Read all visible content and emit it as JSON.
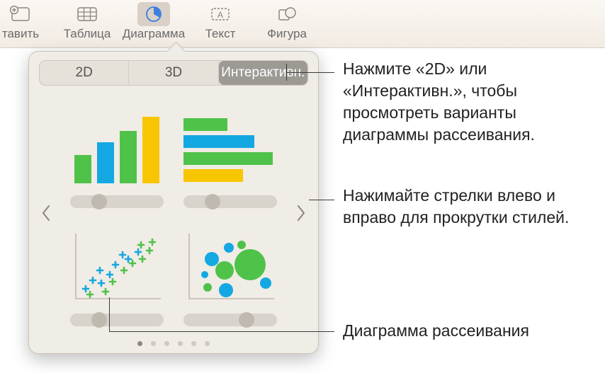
{
  "toolbar": {
    "items": [
      {
        "label": "тавить"
      },
      {
        "label": "Таблица"
      },
      {
        "label": "Диаграмма"
      },
      {
        "label": "Текст"
      },
      {
        "label": "Фигура"
      }
    ]
  },
  "popover": {
    "segments": {
      "two_d": "2D",
      "three_d": "3D",
      "interactive": "Интерактивн."
    },
    "page_dots": 6,
    "active_dot": 0
  },
  "callouts": {
    "c1": "Нажмите «2D» или «Интерактивн.», чтобы просмотреть варианты диаграммы рассеивания.",
    "c2": "Нажимайте стрелки влево и вправо для прокрутки стилей.",
    "c3": "Диаграмма рассеивания"
  },
  "colors": {
    "green": "#4fc249",
    "blue": "#14a8e2",
    "yellow": "#f8c600"
  }
}
